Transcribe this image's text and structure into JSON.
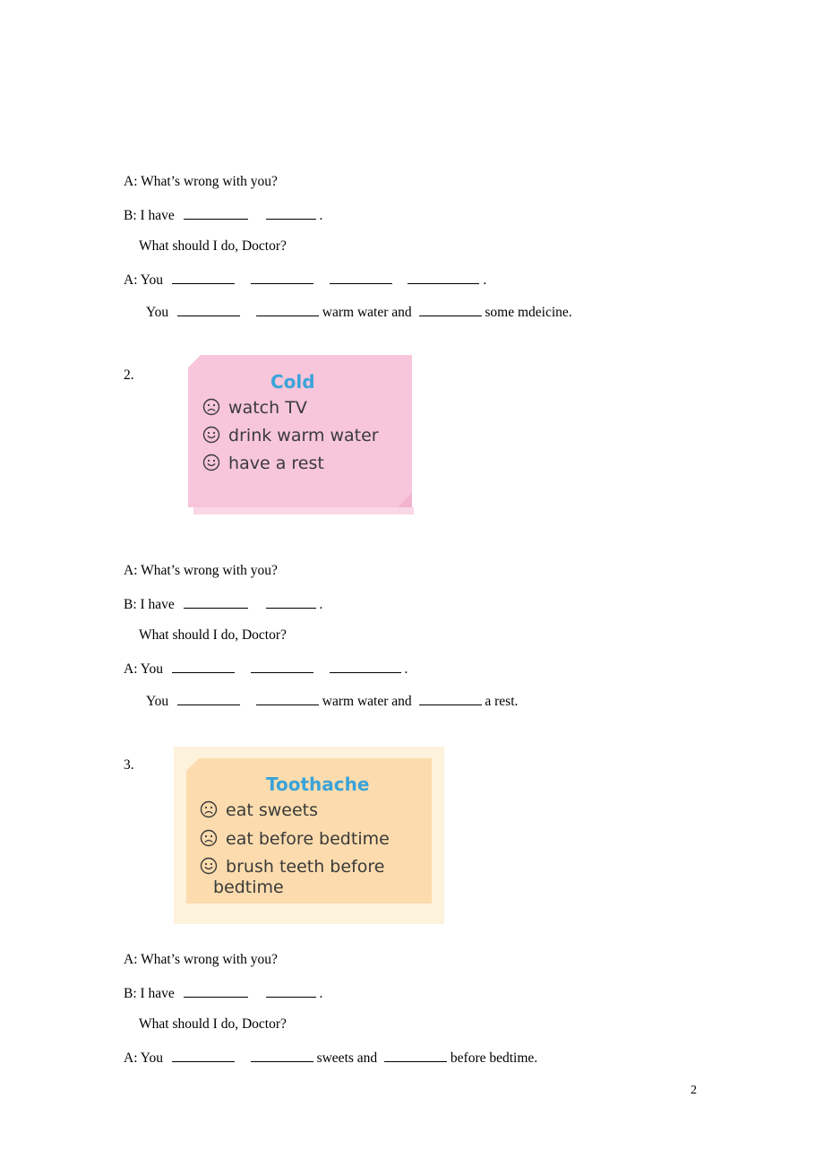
{
  "page": {
    "number": "2"
  },
  "exercises": [
    {
      "id": "ex1",
      "lines": [
        {
          "prefix": "A: What’s wrong with you?"
        },
        {
          "prefix": "B: I have",
          "blanks": [
            72,
            56
          ],
          "suffix": "."
        },
        {
          "prefix": "What should I do, Doctor?"
        },
        {
          "prefix": "A: You",
          "blanks": [
            70,
            70,
            70,
            80
          ],
          "suffix": "."
        },
        {
          "prefix": "You",
          "blanks": [
            70,
            70
          ],
          "mid": "warm water and",
          "blanks2": [
            70
          ],
          "suffix": "some mdeicine."
        }
      ]
    },
    {
      "id": "ex2",
      "number": "2.",
      "card": {
        "title": "Cold",
        "items": [
          {
            "face": "sad",
            "text": "watch TV"
          },
          {
            "face": "happy",
            "text": "drink warm water"
          },
          {
            "face": "happy",
            "text": "have a rest"
          }
        ]
      },
      "lines": [
        {
          "prefix": "A: What’s wrong with you?"
        },
        {
          "prefix": "B: I have",
          "blanks": [
            72,
            56
          ],
          "suffix": "."
        },
        {
          "prefix": "What should I do, Doctor?"
        },
        {
          "prefix": "A: You",
          "blanks": [
            70,
            70,
            80
          ],
          "suffix": "."
        },
        {
          "prefix": "You",
          "blanks": [
            70,
            70
          ],
          "mid": "warm water and",
          "blanks2": [
            70
          ],
          "suffix": "a rest."
        }
      ]
    },
    {
      "id": "ex3",
      "number": "3.",
      "card": {
        "title": "Toothache",
        "items": [
          {
            "face": "sad",
            "text": "eat sweets"
          },
          {
            "face": "sad",
            "text": "eat before bedtime"
          },
          {
            "face": "happy",
            "text": "brush teeth before"
          },
          {
            "face": "none",
            "text": "bedtime"
          }
        ]
      },
      "lines": [
        {
          "prefix": "A: What’s wrong with you?"
        },
        {
          "prefix": "B: I have",
          "blanks": [
            72,
            56
          ],
          "suffix": "."
        },
        {
          "prefix": "What should I do, Doctor?"
        },
        {
          "prefix": "A: You",
          "blanks": [
            70,
            70
          ],
          "mid": "sweets and",
          "blanks2": [
            70
          ],
          "suffix": "before bedtime."
        }
      ]
    }
  ],
  "text": {
    "q_whats_wrong": "A: What’s wrong with you?",
    "b_i_have": "B: I have",
    "what_should_i_do": "What should I do, Doctor?",
    "a_you": "A: You",
    "you": "You",
    "period": ".",
    "warm_water_and": "warm water and",
    "some_medicine": "some mdeicine.",
    "a_rest": "a rest.",
    "sweets_and": "sweets and",
    "before_bedtime": "before bedtime.",
    "num2": "2.",
    "num3": "3.",
    "cold_title": "Cold",
    "cold_item1": "watch TV",
    "cold_item2": "drink warm water",
    "cold_item3": "have a rest",
    "tooth_title": "Toothache",
    "tooth_item1": "eat sweets",
    "tooth_item2": "eat before bedtime",
    "tooth_item3": "brush teeth before",
    "tooth_item3b": "bedtime"
  },
  "colors": {
    "card_cold_bg": "#f7c6da",
    "card_tooth_bg": "#fcdcae",
    "card_tooth_outer": "#fdf2dc",
    "title_blue": "#3aa3d9",
    "card_text": "#3a3a3a"
  }
}
